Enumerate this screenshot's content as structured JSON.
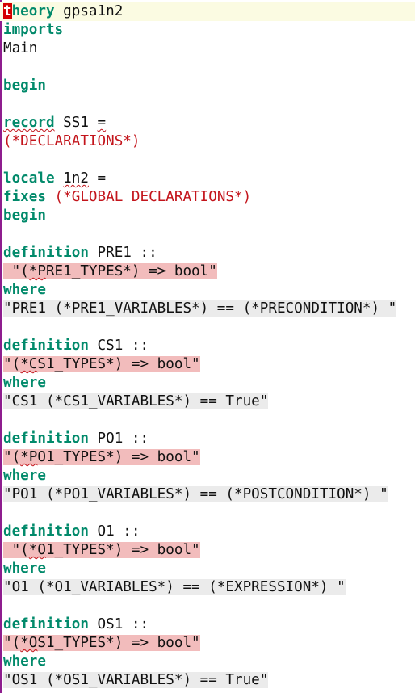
{
  "lines": {
    "l0_cursor": "t",
    "l0_kw": "heory",
    "l0_rest": " gpsa1n2",
    "l1": "imports",
    "l2": "Main",
    "l4": "begin",
    "l6_kw": "record",
    "l6_rest": " SS1 ",
    "l6_eq": "=",
    "l7": "(*DECLARATIONS*)",
    "l9_kw": "locale",
    "l9_sp": " ",
    "l9_name": "1n2",
    "l9_rest": " =",
    "l10_kw": "fixes",
    "l10_cmt": " (*GLOBAL DECLARATIONS*)",
    "l11": "begin",
    "l13_kw": "definition",
    "l13_rest": " PRE1 ::",
    "l14_a": " \"(",
    "l14_b": "*P",
    "l14_c": "RE1_TYPES*) => bool\"",
    "l15": "where",
    "l16": "\"PRE1 (*PRE1_VARIABLES*) == (*PRECONDITION*) \"",
    "l18_kw": "definition",
    "l18_rest": " CS1 ::",
    "l19_a": "\"(",
    "l19_b": "*C",
    "l19_c": "S1_TYPES*) => bool\"",
    "l20": "where",
    "l21": "\"CS1 (*CS1_VARIABLES*) == True\"",
    "l23_kw": "definition",
    "l23_rest": " PO1 ::",
    "l24_a": "\"(",
    "l24_b": "*P",
    "l24_c": "O1_TYPES*) => bool\"",
    "l25": "where",
    "l26": "\"PO1 (*PO1_VARIABLES*) == (*POSTCONDITION*) \"",
    "l28_kw": "definition",
    "l28_rest": " O1 ::",
    "l29_a": " \"(",
    "l29_b": "*O",
    "l29_c": "1_TYPES*) => bool\"",
    "l30": "where",
    "l31": "\"O1 (*O1_VARIABLES*) == (*EXPRESSION*) \"",
    "l33_kw": "definition",
    "l33_rest": " OS1 ::",
    "l34_a": "\"(",
    "l34_b": "*O",
    "l34_c": "S1_TYPES*) => bool\"",
    "l35": "where",
    "l36": "\"OS1 (*OS1_VARIABLES*) == True\""
  },
  "colors": {
    "keyword": "#028a6b",
    "comment": "#c3141b",
    "error_highlight": "#f2bcbc",
    "string_highlight": "#ebebeb",
    "gutter": "#8e1d8e",
    "current_line": "#fbfbe2"
  }
}
